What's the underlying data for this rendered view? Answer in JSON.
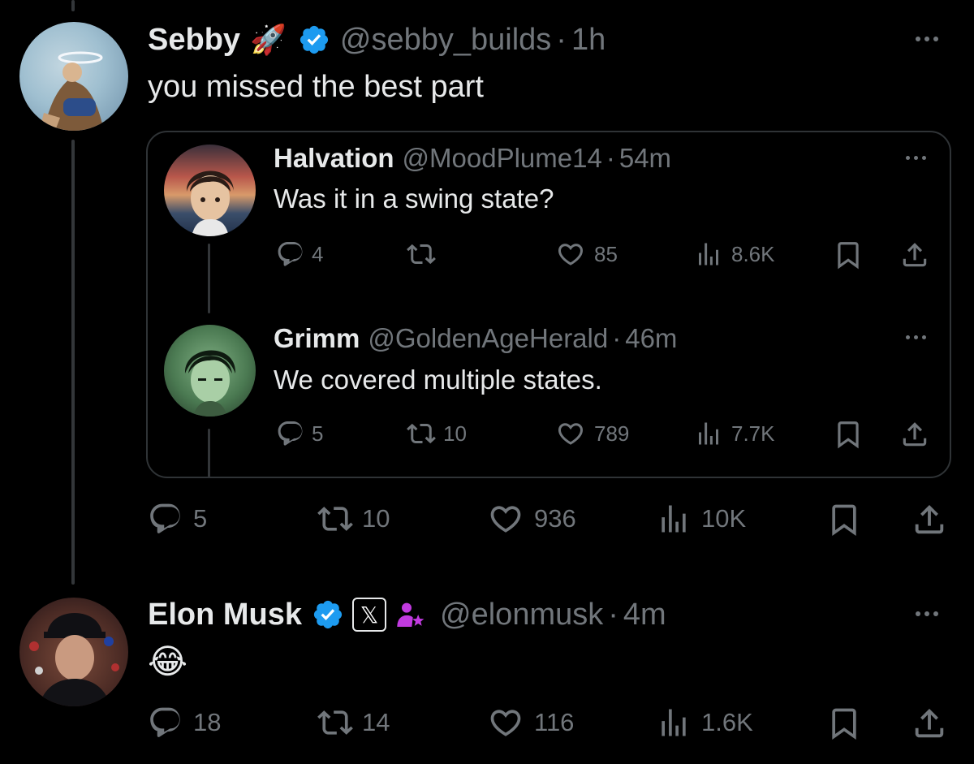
{
  "tweet1": {
    "name": "Sebby",
    "emoji": "🚀",
    "handle": "@sebby_builds",
    "sep": "·",
    "time": "1h",
    "text": "you missed the best part",
    "actions": {
      "replies": "5",
      "reposts": "10",
      "likes": "936",
      "views": "10K"
    }
  },
  "quote": {
    "reply1": {
      "name": "Halvation",
      "handle": "@MoodPlume14",
      "sep": "·",
      "time": "54m",
      "text": "Was it in a swing state?",
      "actions": {
        "replies": "4",
        "reposts": "",
        "likes": "85",
        "views": "8.6K"
      }
    },
    "reply2": {
      "name": "Grimm",
      "handle": "@GoldenAgeHerald",
      "sep": "·",
      "time": "46m",
      "text": "We covered multiple states.",
      "actions": {
        "replies": "5",
        "reposts": "10",
        "likes": "789",
        "views": "7.7K"
      }
    }
  },
  "tweet2": {
    "name": "Elon Musk",
    "x_badge": "𝕏",
    "handle": "@elonmusk",
    "sep": "·",
    "time": "4m",
    "text": "😂",
    "actions": {
      "replies": "18",
      "reposts": "14",
      "likes": "116",
      "views": "1.6K"
    }
  },
  "colors": {
    "background": "#000000",
    "text": "#e7e9ea",
    "muted": "#71767b",
    "verified": "#1d9bf0",
    "border": "#2f3336",
    "affiliate": "#c13adf"
  }
}
